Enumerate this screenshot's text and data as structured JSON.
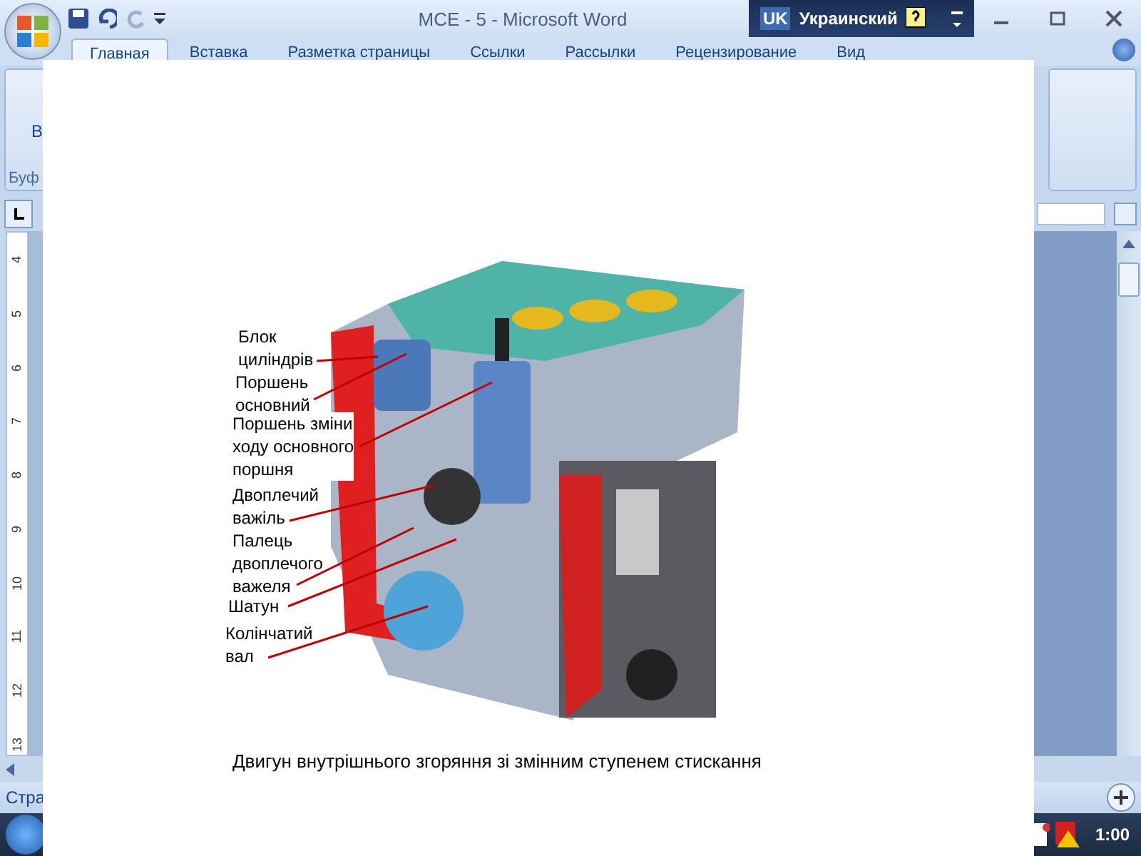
{
  "window": {
    "title": "MCE - 5 - Microsoft Word"
  },
  "language_bar": {
    "code": "UK",
    "language": "Украинский"
  },
  "ribbon_tabs": [
    {
      "label": "Главная",
      "selected": true
    },
    {
      "label": "Вставка",
      "selected": false
    },
    {
      "label": "Разметка страницы",
      "selected": false
    },
    {
      "label": "Ссылки",
      "selected": false
    },
    {
      "label": "Рассылки",
      "selected": false
    },
    {
      "label": "Рецензирование",
      "selected": false
    },
    {
      "label": "Вид",
      "selected": false
    }
  ],
  "ribbon": {
    "button_label": "В",
    "group_label": "Буф"
  },
  "vertical_ruler": {
    "numbers": [
      "4",
      "5",
      "6",
      "7",
      "8",
      "9",
      "10",
      "11",
      "12",
      "13"
    ]
  },
  "status_bar": {
    "page": "Стра"
  },
  "taskbar": {
    "clock": "1:00"
  },
  "figure": {
    "labels": [
      {
        "lines": [
          "Блок",
          "циліндрів"
        ]
      },
      {
        "lines": [
          "Поршень",
          "основний"
        ]
      },
      {
        "lines": [
          "Поршень зміни",
          "ходу основного",
          "поршня"
        ]
      },
      {
        "lines": [
          "Двоплечий",
          "важіль"
        ]
      },
      {
        "lines": [
          "Палець",
          "двоплечого",
          "важеля"
        ]
      },
      {
        "lines": [
          "Шатун"
        ]
      },
      {
        "lines": [
          "Колінчатий",
          "вал"
        ]
      }
    ],
    "caption": "Двигун внутрішнього згоряння зі змінним ступенем стискання"
  }
}
